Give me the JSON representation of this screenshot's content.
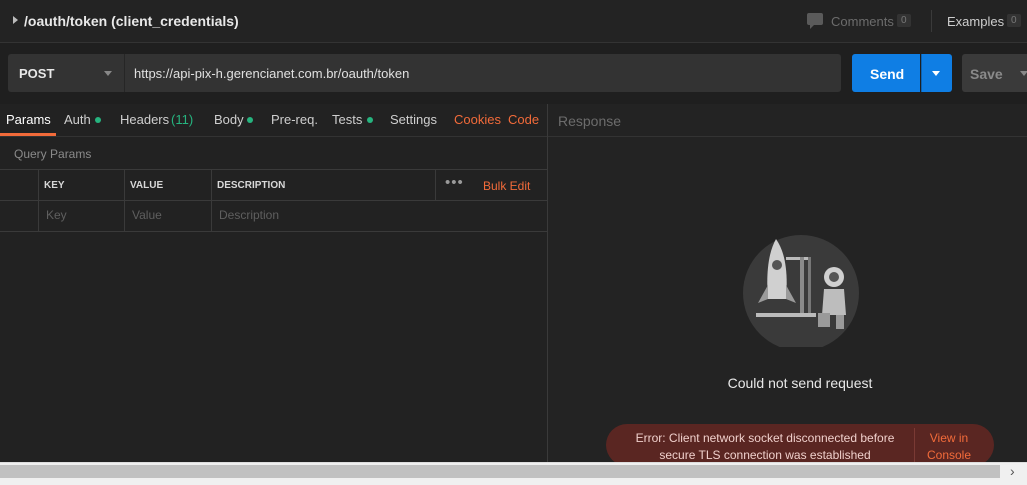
{
  "header": {
    "title": "/oauth/token (client_credentials)",
    "comments_label": "Comments",
    "comments_count": "0",
    "examples_label": "Examples",
    "examples_count": "0"
  },
  "request": {
    "method": "POST",
    "url": "https://api-pix-h.gerencianet.com.br/oauth/token",
    "send_label": "Send",
    "save_label": "Save"
  },
  "tabs": {
    "params": "Params",
    "auth": "Auth",
    "headers": "Headers",
    "headers_count": "(11)",
    "body": "Body",
    "prereq": "Pre-req.",
    "tests": "Tests",
    "settings": "Settings",
    "cookies": "Cookies",
    "code": "Code"
  },
  "query_params": {
    "label": "Query Params",
    "columns": [
      "KEY",
      "VALUE",
      "DESCRIPTION"
    ],
    "bulk_edit": "Bulk Edit",
    "more": "•••",
    "placeholders": [
      "Key",
      "Value",
      "Description"
    ]
  },
  "response": {
    "label": "Response",
    "message": "Could not send request",
    "error_line1": "Error: Client network socket disconnected before",
    "error_line2": "secure TLS connection was established",
    "view_line1": "View in",
    "view_line2": "Console"
  },
  "icons": [
    "chevron-right-icon",
    "comments-icon",
    "chevron-down-icon",
    "rocket-illustration",
    "arrow-right-icon"
  ],
  "colors": {
    "accent": "#f26b3a",
    "send_blue": "#0f7ee4",
    "status_green": "#26b47f",
    "error_bg": "#5a2622"
  }
}
